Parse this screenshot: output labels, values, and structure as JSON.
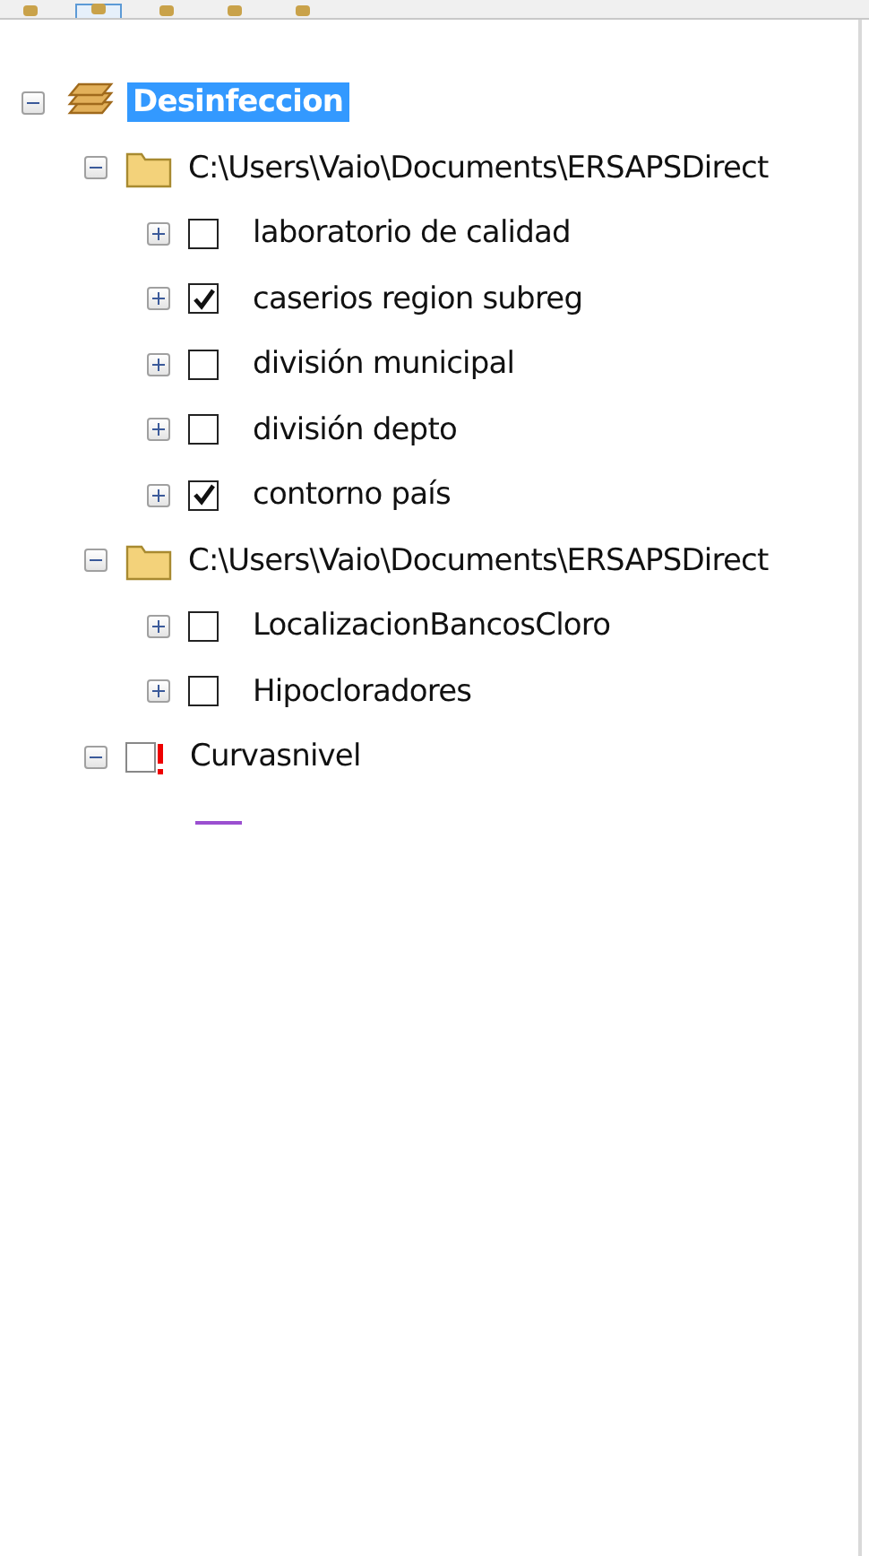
{
  "toolbar": {
    "buttons": [
      {
        "selected": false
      },
      {
        "selected": true
      },
      {
        "selected": false
      },
      {
        "selected": false
      },
      {
        "selected": false
      }
    ]
  },
  "tree": [
    {
      "kind": "data_frame",
      "label": "Desinfeccion",
      "expanded": true,
      "selected": true,
      "children": [
        {
          "kind": "folder",
          "label": "C:\\Users\\Vaio\\Documents\\ERSAPSDirect",
          "expanded": true,
          "selected": false,
          "children": [
            {
              "kind": "layer",
              "label": "laboratorio de calidad",
              "expanded": false,
              "checked": false,
              "selected": false
            },
            {
              "kind": "layer",
              "label": "caserios region subreg",
              "expanded": false,
              "checked": true,
              "selected": false
            },
            {
              "kind": "layer",
              "label": "división municipal",
              "expanded": false,
              "checked": false,
              "selected": false
            },
            {
              "kind": "layer",
              "label": "división depto",
              "expanded": false,
              "checked": false,
              "selected": false
            },
            {
              "kind": "layer",
              "label": "contorno país",
              "expanded": false,
              "checked": true,
              "selected": false
            }
          ]
        },
        {
          "kind": "folder",
          "label": "C:\\Users\\Vaio\\Documents\\ERSAPSDirect",
          "expanded": true,
          "selected": false,
          "children": [
            {
              "kind": "layer",
              "label": "LocalizacionBancosCloro",
              "expanded": false,
              "checked": false,
              "selected": false
            },
            {
              "kind": "layer",
              "label": "Hipocloradores",
              "expanded": false,
              "checked": false,
              "selected": false
            }
          ]
        },
        {
          "kind": "broken_layer",
          "label": "Curvasnivel",
          "expanded": true,
          "checked": false,
          "selected": false,
          "legend": {
            "kind": "line",
            "color": "#9b4fd0"
          }
        }
      ]
    }
  ]
}
